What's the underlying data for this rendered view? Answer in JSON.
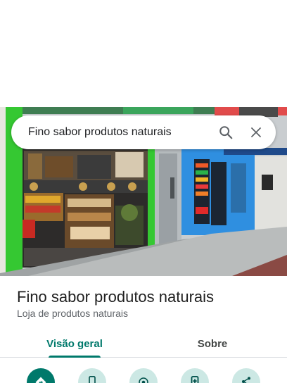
{
  "search": {
    "query": "Fino sabor produtos naturais",
    "search_icon": "search-icon",
    "close_icon": "close-icon"
  },
  "place": {
    "name": "Fino sabor produtos naturais",
    "category": "Loja de produtos naturais"
  },
  "tabs": [
    {
      "label": "Visão geral",
      "active": true
    },
    {
      "label": "Sobre",
      "active": false
    }
  ],
  "actions": [
    {
      "icon": "directions-icon"
    },
    {
      "icon": "phone-icon"
    },
    {
      "icon": "nearby-icon"
    },
    {
      "icon": "save-to-phone-icon"
    },
    {
      "icon": "share-icon"
    }
  ],
  "colors": {
    "accent": "#00796b",
    "action_bg": "#cce8e4",
    "storefront_green": "#35c832",
    "storefront_blue": "#2f8fe0"
  }
}
